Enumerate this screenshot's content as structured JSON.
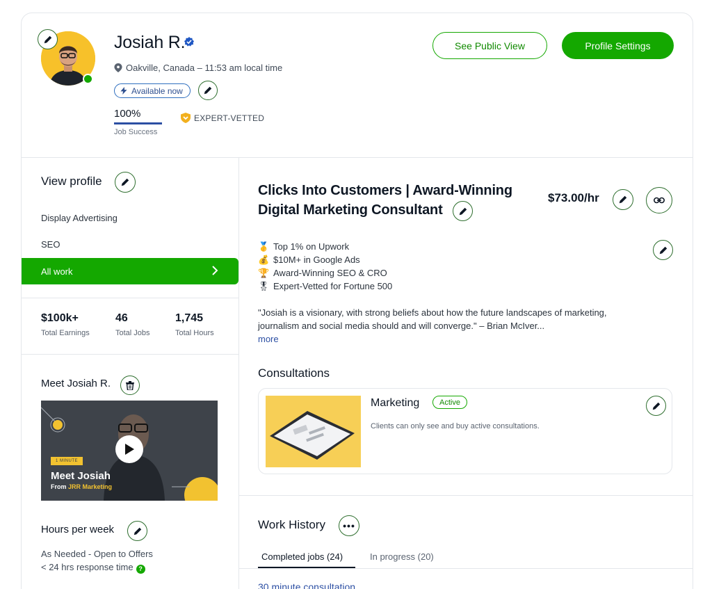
{
  "profile": {
    "name": "Josiah R.",
    "location": "Oakville, Canada – 11:53 am local time",
    "availability": "Available now",
    "job_success": {
      "percent_label": "100%",
      "percent_value": 100,
      "label": "Job Success"
    },
    "expert_badge": "EXPERT-VETTED"
  },
  "header_actions": {
    "public_view": "See Public View",
    "settings": "Profile Settings"
  },
  "sidebar": {
    "view_profile": "View profile",
    "items": [
      {
        "label": "Display Advertising"
      },
      {
        "label": "SEO"
      },
      {
        "label": "All work",
        "selected": true
      }
    ],
    "stats": [
      {
        "value": "$100k+",
        "label": "Total Earnings"
      },
      {
        "value": "46",
        "label": "Total Jobs"
      },
      {
        "value": "1,745",
        "label": "Total Hours"
      }
    ],
    "meet_title": "Meet Josiah R.",
    "video": {
      "tag": "1 MINUTE",
      "title": "Meet Josiah",
      "sub_prefix": "From ",
      "sub_brand": "JRR Marketing"
    },
    "hours_title": "Hours per week",
    "hours_lines": [
      "As Needed - Open to Offers",
      "< 24 hrs response time"
    ]
  },
  "main": {
    "headline_line1": "Clicks Into Customers | Award-Winning",
    "headline_line2": "Digital Marketing Consultant",
    "rate": "$73.00/hr",
    "bullets": [
      {
        "emoji": "🥇",
        "text": "Top 1% on Upwork"
      },
      {
        "emoji": "💰",
        "text": "$10M+ in Google Ads"
      },
      {
        "emoji": "🏆",
        "text": "Award-Winning SEO & CRO"
      },
      {
        "emoji": "🎖",
        "text": "Expert-Vetted for Fortune 500"
      }
    ],
    "quote": "\"Josiah is a visionary, with strong beliefs about how the future landscapes of marketing, journalism and social media should and will converge.\" – Brian McIver...",
    "more": "more",
    "consultations": {
      "title": "Consultations",
      "name": "Marketing",
      "status": "Active",
      "description": "Clients can only see and buy active consultations."
    },
    "work_history": {
      "title": "Work History",
      "tabs": [
        {
          "label": "Completed jobs (24)",
          "active": true
        },
        {
          "label": "In progress (20)",
          "active": false
        }
      ],
      "first_job": "30 minute consultation"
    }
  },
  "colors": {
    "brand_green": "#14a800",
    "link_blue": "#2c4fa3",
    "avatar_yellow": "#f7c12a"
  },
  "icons": {
    "edit": "pencil-icon",
    "location": "map-pin-icon",
    "verified": "verified-check-icon",
    "availability": "lightning-icon",
    "link": "link-icon",
    "delete": "trash-icon",
    "more": "more-dots-icon",
    "play": "play-icon",
    "nav": "chevron-right-icon"
  }
}
